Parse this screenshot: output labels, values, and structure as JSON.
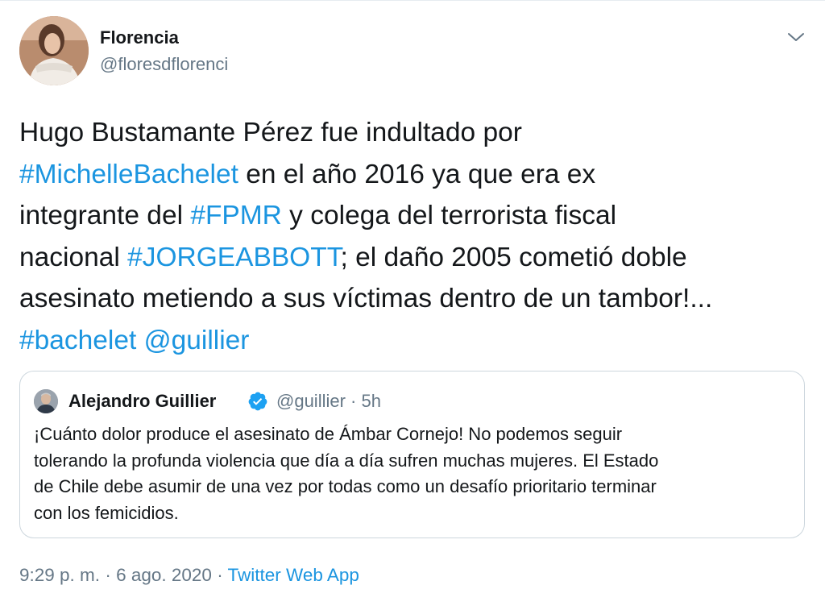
{
  "tweet": {
    "author_name": "Florencia",
    "author_handle": "@floresdflorenci",
    "menu_icon": "chevron-down-icon",
    "body": {
      "line1": "Hugo Bustamante Pérez fue indultado por",
      "line2_link": "#MichelleBachelet",
      "line2_text": " en el año 2016 ya que era ex",
      "line3_text": "integrante del ",
      "line3_link": "#FPMR",
      "line3_text2": " y colega del terrorista fiscal",
      "line4_text": "nacional ",
      "line4_link": "#JORGEABBOTT",
      "line4_text2": "; el daño 2005 cometió doble",
      "line5": "asesinato metiendo a sus víctimas dentro de un tambor!...",
      "line6_link1": "#bachelet",
      "line6_space": " ",
      "line6_link2": "@guillier"
    },
    "quote": {
      "author_name": "Alejandro Guillier",
      "verified_icon": "verified-badge-icon",
      "author_handle": "@guillier",
      "separator": " · ",
      "time": "5h",
      "lines": [
        "¡Cuánto dolor produce el asesinato de Ámbar Cornejo! No podemos seguir",
        "tolerando la profunda violencia que día a día sufren muchas mujeres. El Estado",
        "de Chile debe asumir de una vez por todas como un desafío prioritario terminar",
        "con los femicidios."
      ]
    },
    "footer": {
      "time": "9:29 p. m.",
      "sep1": " · ",
      "date": "6 ago. 2020",
      "sep2": " · ",
      "source": "Twitter Web App"
    }
  },
  "colors": {
    "link": "#1b95e0",
    "text": "#14171a",
    "secondary": "#657786",
    "border": "#ccd6dd"
  }
}
